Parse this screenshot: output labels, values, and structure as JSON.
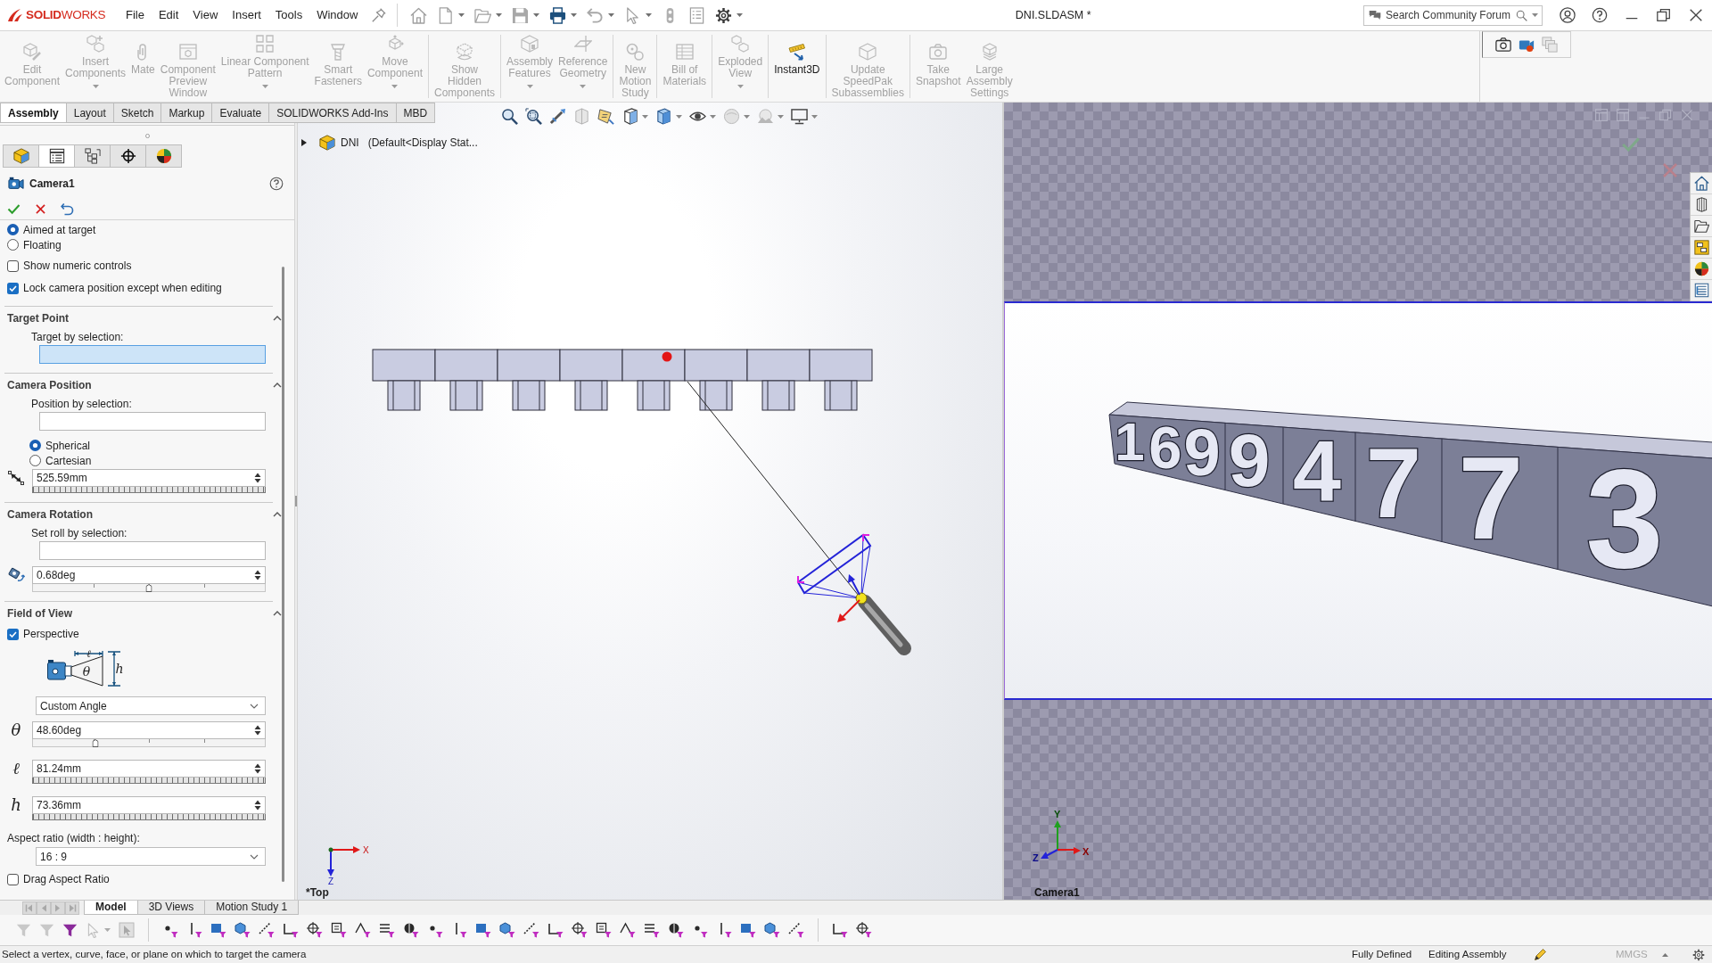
{
  "title_bar": {
    "app_name": "**SOLID**WORKS",
    "menus": [
      "File",
      "Edit",
      "View",
      "Insert",
      "Tools",
      "Window"
    ],
    "document_title": "DNI.SLDASM *",
    "search": {
      "placeholder": "Search Community Forum"
    }
  },
  "command_manager": {
    "groups": [
      [
        {
          "label": "Edit\nComponent",
          "disabled": true,
          "has_menu": false
        },
        {
          "label": "Insert\nComponents",
          "disabled": true,
          "has_menu": true
        },
        {
          "label": "Mate",
          "disabled": true,
          "has_menu": false
        },
        {
          "label": "Component\nPreview\nWindow",
          "disabled": true,
          "has_menu": false
        },
        {
          "label": "Linear Component\nPattern",
          "disabled": true,
          "has_menu": true
        },
        {
          "label": "Smart\nFasteners",
          "disabled": true,
          "has_menu": false
        },
        {
          "label": "Move\nComponent",
          "disabled": true,
          "has_menu": true
        }
      ],
      [
        {
          "label": "Show\nHidden\nComponents",
          "disabled": true,
          "has_menu": false
        }
      ],
      [
        {
          "label": "Assembly\nFeatures",
          "disabled": true,
          "has_menu": true
        },
        {
          "label": "Reference\nGeometry",
          "disabled": true,
          "has_menu": true
        }
      ],
      [
        {
          "label": "New\nMotion\nStudy",
          "disabled": true,
          "has_menu": false
        }
      ],
      [
        {
          "label": "Bill of\nMaterials",
          "disabled": true,
          "has_menu": false
        }
      ],
      [
        {
          "label": "Exploded\nView",
          "disabled": true,
          "has_menu": true
        }
      ],
      [
        {
          "label": "Instant3D",
          "disabled": false,
          "has_menu": false
        }
      ],
      [
        {
          "label": "Update\nSpeedPak\nSubassemblies",
          "disabled": true,
          "has_menu": false
        }
      ],
      [
        {
          "label": "Take\nSnapshot",
          "disabled": true,
          "has_menu": false
        },
        {
          "label": "Large\nAssembly\nSettings",
          "disabled": true,
          "has_menu": false
        }
      ]
    ]
  },
  "tabs": [
    {
      "label": "Assembly",
      "selected": true
    },
    {
      "label": "Layout",
      "selected": false
    },
    {
      "label": "Sketch",
      "selected": false
    },
    {
      "label": "Markup",
      "selected": false
    },
    {
      "label": "Evaluate",
      "selected": false
    },
    {
      "label": "SOLIDWORKS Add-Ins",
      "selected": false
    },
    {
      "label": "MBD",
      "selected": false
    }
  ],
  "property_manager": {
    "panel_tabs": [
      {
        "selected": false
      },
      {
        "selected": true
      },
      {
        "selected": false
      },
      {
        "selected": false
      },
      {
        "selected": false
      }
    ],
    "title": "Camera1",
    "items": [
      {
        "kind": "radio",
        "label": "Aimed at target",
        "selected": true
      },
      {
        "kind": "radio",
        "label": "Floating",
        "selected": false
      },
      {
        "kind": "checkbox",
        "label": "Show numeric controls",
        "checked": false
      },
      {
        "kind": "checkbox",
        "label": "Lock camera position except when editing",
        "checked": true
      },
      {
        "kind": "section",
        "title": "Target Point",
        "expanded": true,
        "items": [
          {
            "kind": "selection",
            "label": "Target by selection:",
            "active": true
          }
        ]
      },
      {
        "kind": "section",
        "title": "Camera Position",
        "expanded": true,
        "items": [
          {
            "kind": "selection",
            "label": "Position by selection:",
            "active": false
          },
          {
            "kind": "radio",
            "label": "Spherical",
            "selected": true
          },
          {
            "kind": "radio",
            "label": "Cartesian",
            "selected": false
          },
          {
            "kind": "wheel_field",
            "value": "525.59mm"
          }
        ]
      },
      {
        "kind": "section",
        "title": "Camera Rotation",
        "expanded": true,
        "items": [
          {
            "kind": "selection",
            "label": "Set roll by selection:",
            "active": false
          },
          {
            "kind": "slider_field",
            "value": "0.68deg",
            "level": 0.5
          }
        ]
      },
      {
        "kind": "section",
        "title": "Field of View",
        "expanded": true,
        "items": [
          {
            "kind": "checkbox",
            "label": "Perspective",
            "checked": true
          },
          {
            "kind": "diagram",
            "labels": [
              "ℓ",
              "θ",
              "h"
            ]
          },
          {
            "kind": "dropdown",
            "value": "Custom Angle"
          },
          {
            "kind": "slider_field",
            "symbol": "θ",
            "value": "48.60deg",
            "level": 0.27
          },
          {
            "kind": "wheel_field",
            "symbol": "ℓ",
            "value": "81.24mm"
          },
          {
            "kind": "wheel_field",
            "symbol": "h",
            "value": "73.36mm"
          },
          {
            "kind": "label",
            "label": "Aspect ratio (width : height):"
          },
          {
            "kind": "dropdown",
            "value": "16 : 9"
          },
          {
            "kind": "checkbox",
            "label": "Drag Aspect Ratio",
            "checked": false
          }
        ]
      }
    ]
  },
  "graphics_area": {
    "tree_root": {
      "name": "DNI",
      "state": "(Default<Display Stat...",
      "expanded": false
    },
    "axis_labels": [
      "X",
      "Z"
    ],
    "view_name": "*Top"
  },
  "camera_view": {
    "digits": [
      "1",
      "6",
      "9",
      "9",
      "4",
      "7",
      "7",
      "3"
    ],
    "axis_labels": [
      "Y",
      "X",
      "Z"
    ],
    "view_name": "Camera1"
  },
  "bottom_tabs": [
    {
      "label": "Model",
      "selected": true
    },
    {
      "label": "3D Views",
      "selected": false
    },
    {
      "label": "Motion Study 1",
      "selected": false
    }
  ],
  "status_bar": {
    "message": "Select a vertex, curve, face, or plane on which to target the camera",
    "state": "Fully Defined",
    "mode": "Editing Assembly",
    "units": "MMGS"
  }
}
